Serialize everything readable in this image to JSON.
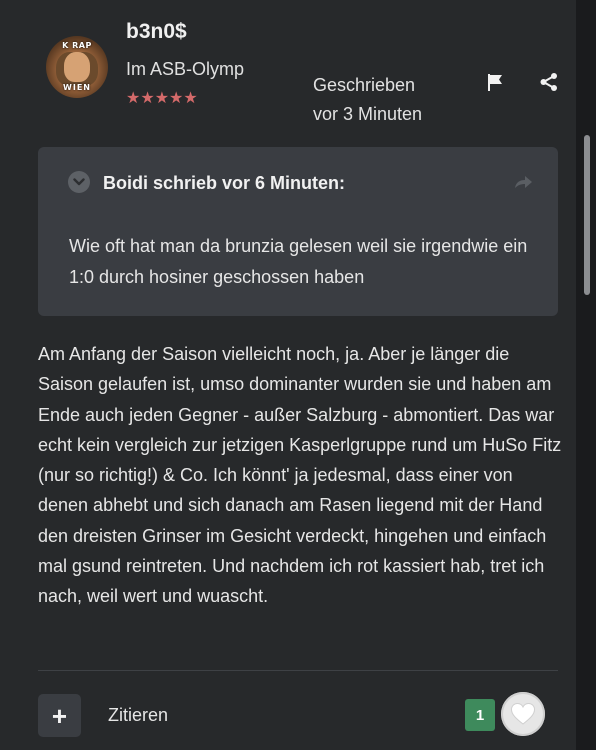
{
  "post": {
    "author": {
      "name": "b3n0$",
      "rank": "Im ASB-Olymp",
      "stars": "★★★★★",
      "avatar_text_top": "K RAP",
      "avatar_text_bottom": "WIEN"
    },
    "posted_line1": "Geschrieben",
    "posted_line2": "vor 3 Minuten",
    "quote": {
      "author_line": "Boidi schrieb vor 6 Minuten:",
      "text": "Wie oft hat man da brunzia gelesen weil sie irgendwie ein 1:0 durch hosiner geschossen haben"
    },
    "body": "Am Anfang der Saison vielleicht noch, ja. Aber je länger die Saison gelaufen ist, umso dominanter wurden sie und haben am Ende auch jeden Gegner - außer Salzburg - abmontiert. Das war echt kein vergleich zur jetzigen Kasperlgruppe rund um HuSo Fitz (nur so richtig!) & Co. Ich könnt' ja jedesmal, dass einer von denen abhebt und sich danach am Rasen liegend mit der Hand den dreisten Grinser im Gesicht verdeckt, hingehen und einfach mal gsund reintreten. Und nachdem ich rot kassiert hab, tret ich nach, weil wert und wuascht.",
    "actions": {
      "add_symbol": "+",
      "quote_label": "Zitieren",
      "reaction_count": "1"
    }
  },
  "colors": {
    "background": "#27292b",
    "quote_bg": "#3a3d42",
    "stars": "#d46a6a",
    "reaction_badge": "#3e8a5c"
  },
  "icons": [
    "flag-icon",
    "share-icon",
    "chevron-down-icon",
    "share-arrow-icon",
    "plus-icon",
    "heart-icon"
  ]
}
